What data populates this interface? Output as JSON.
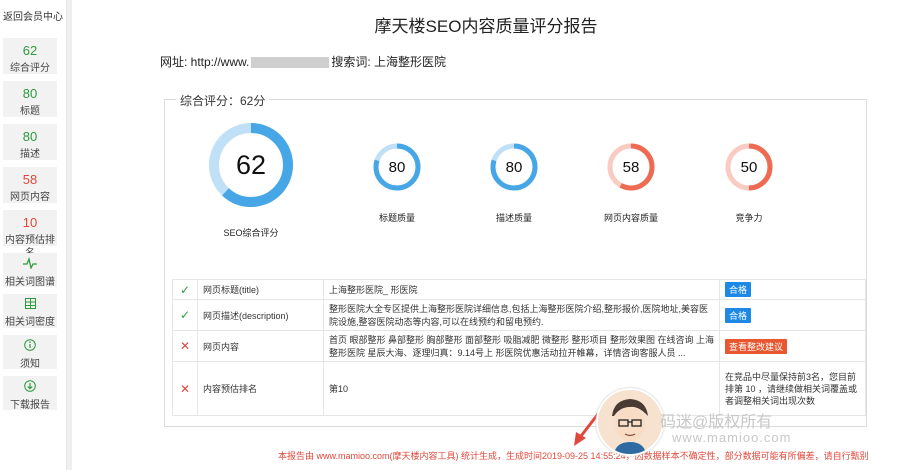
{
  "sidebar": {
    "back": "返回会员中心",
    "items": [
      {
        "num": "62",
        "label": "综合评分",
        "color": "#2e9a3e"
      },
      {
        "num": "80",
        "label": "标题",
        "color": "#2e9a3e"
      },
      {
        "num": "80",
        "label": "描述",
        "color": "#2e9a3e"
      },
      {
        "num": "58",
        "label": "网页内容",
        "color": "#e0483c"
      },
      {
        "num": "10",
        "label": "内容预估排名",
        "color": "#e0483c"
      }
    ],
    "tools": [
      {
        "icon": "pulse-icon",
        "label": "相关词图谱"
      },
      {
        "icon": "grid-icon",
        "label": "相关词密度"
      },
      {
        "icon": "info-icon",
        "label": "须知"
      },
      {
        "icon": "download-icon",
        "label": "下载报告"
      }
    ]
  },
  "title": "摩天楼SEO内容质量评分报告",
  "url_line": {
    "prefix": "网址: http://www.",
    "keyword_label": "搜索词:",
    "keyword": "上海整形医院"
  },
  "summary_legend": "综合评分：62分",
  "main_score": {
    "value": "62",
    "label": "SEO综合评分",
    "ratio": 0.62,
    "color": "#47a6e6"
  },
  "sub_scores": [
    {
      "value": "80",
      "label": "标题质量",
      "ratio": 0.8,
      "color": "#47a6e6"
    },
    {
      "value": "80",
      "label": "描述质量",
      "ratio": 0.8,
      "color": "#47a6e6"
    },
    {
      "value": "58",
      "label": "网页内容质量",
      "ratio": 0.58,
      "color": "#ef6a53"
    },
    {
      "value": "50",
      "label": "竞争力",
      "ratio": 0.5,
      "color": "#ef6a53"
    }
  ],
  "rows": [
    {
      "status": "ok",
      "name": "网页标题(title)",
      "content": "上海整形医院_ 形医院",
      "action": "合格",
      "action_type": "blue"
    },
    {
      "status": "ok",
      "name": "网页描述(description)",
      "content": "整形医院大全专区提供上海整形医院详细信息,包括上海整形医院介绍,整形报价,医院地址,美容医院设施,整容医院动态等内容,可以在线预约和留电预约.",
      "action": "合格",
      "action_type": "blue"
    },
    {
      "status": "bad",
      "name": "网页内容",
      "content": "首页 眼部整形 鼻部整形 胸部整形 面部整形 吸脂减肥 微整形 整形项目 整形效果图 在线咨询 上海整形医院 星辰大海、逐理归真：9.14号上 形医院优惠活动拉开帷幕，详情咨询客服人员 ...",
      "action": "查看整改建议",
      "action_type": "orange"
    },
    {
      "status": "bad",
      "name": "内容预估排名",
      "content": "第10",
      "action": "在竞品中尽量保持前3名，您目前排第 10 ，请继续做相关词覆盖或者调整相关词出现次数",
      "action_type": "text"
    }
  ],
  "footer": {
    "prefix": "本报告由 www.mamioo.com(摩天楼内容工具) 统计生成，生成时间",
    "time": "2019-09-25 14:55:24",
    "suffix": "，因数据样本不确定性，部分数据可能有所偏差，请自行甄别"
  },
  "watermark": {
    "line1": "码迷@版权所有",
    "line2": "www.mamioo.com"
  }
}
